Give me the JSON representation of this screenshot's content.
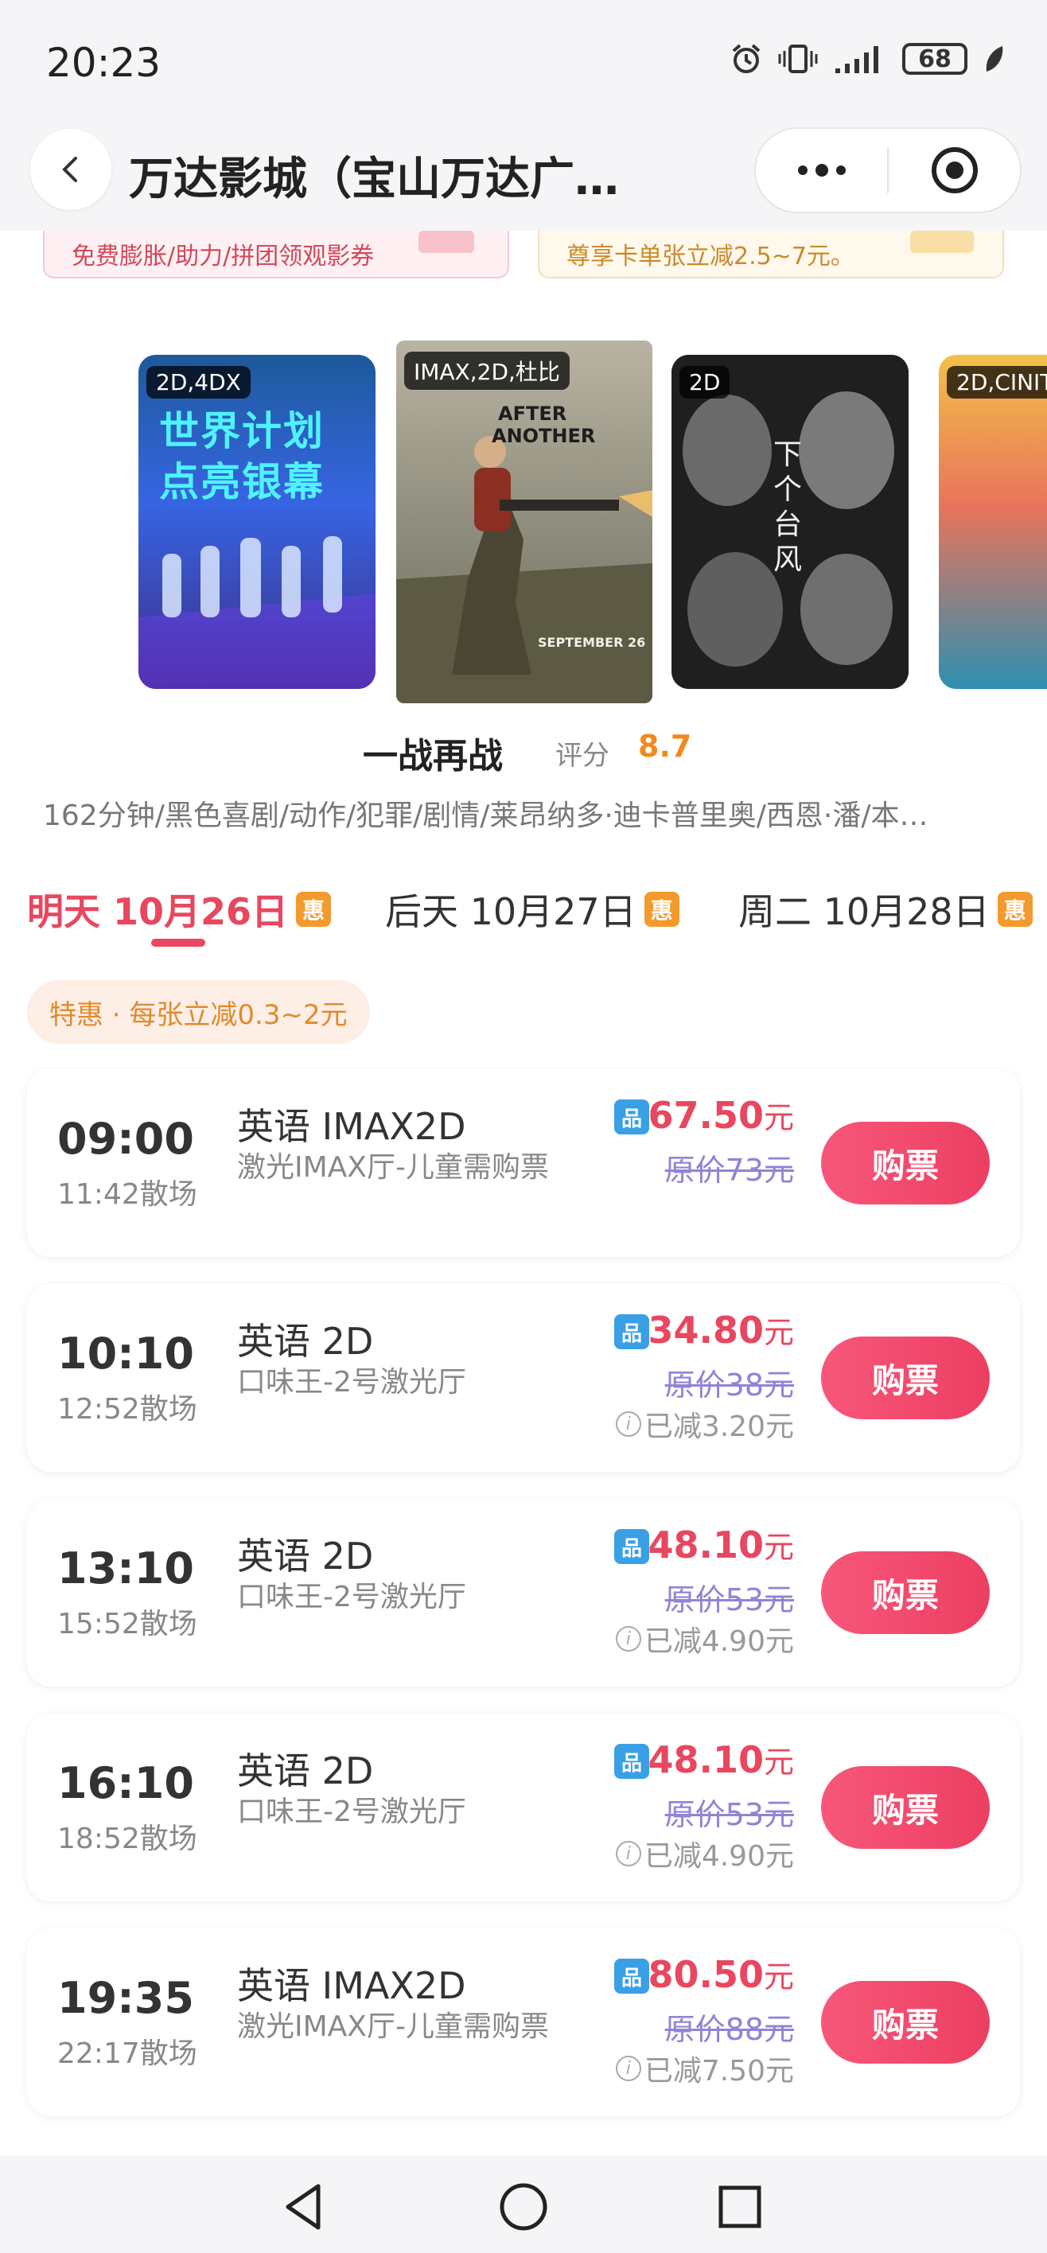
{
  "status": {
    "time": "20:23",
    "battery": "68"
  },
  "header": {
    "title": "万达影城（宝山万达广…"
  },
  "promos": {
    "left": "免费膨胀/助力/拼团领观影券",
    "right": "尊享卡单张立减2.5~7元。"
  },
  "posters": [
    {
      "tag": "2D,4DX",
      "line1": "世界计划",
      "line2": "点亮银幕"
    },
    {
      "tag": "IMAX,2D,杜比",
      "line1": "AFTER",
      "line2": "ANOTHER",
      "line3": "SEPTEMBER 26"
    },
    {
      "tag": "2D",
      "line1": "下",
      "line2": "个",
      "line3": "台",
      "line4": "风"
    },
    {
      "tag": "2D,CINIT"
    }
  ],
  "movie": {
    "title": "一战再战",
    "rating_label": "评分",
    "rating": "8.7",
    "info": "162分钟/黑色喜剧/动作/犯罪/剧情/莱昂纳多·迪卡普里奥/西恩·潘/本…"
  },
  "date_tabs": [
    {
      "label": "明天 10月26日",
      "badge": "惠",
      "active": true
    },
    {
      "label": "后天 10月27日",
      "badge": "惠",
      "active": false
    },
    {
      "label": "周二 10月28日",
      "badge": "惠",
      "active": false
    }
  ],
  "discount": "特惠 · 每张立减0.3~2元",
  "showtimes": [
    {
      "time": "09:00",
      "end": "11:42散场",
      "lang": "英语 IMAX2D",
      "hall": "激光IMAX厅-儿童需购票",
      "pin": "品",
      "price": "67.50",
      "unit": "元",
      "orig": "原价73元",
      "saved": "",
      "buy": "购票"
    },
    {
      "time": "10:10",
      "end": "12:52散场",
      "lang": "英语 2D",
      "hall": "口味王-2号激光厅",
      "pin": "品",
      "price": "34.80",
      "unit": "元",
      "orig": "原价38元",
      "saved": "已减3.20元",
      "buy": "购票"
    },
    {
      "time": "13:10",
      "end": "15:52散场",
      "lang": "英语 2D",
      "hall": "口味王-2号激光厅",
      "pin": "品",
      "price": "48.10",
      "unit": "元",
      "orig": "原价53元",
      "saved": "已减4.90元",
      "buy": "购票"
    },
    {
      "time": "16:10",
      "end": "18:52散场",
      "lang": "英语 2D",
      "hall": "口味王-2号激光厅",
      "pin": "品",
      "price": "48.10",
      "unit": "元",
      "orig": "原价53元",
      "saved": "已减4.90元",
      "buy": "购票"
    },
    {
      "time": "19:35",
      "end": "22:17散场",
      "lang": "英语 IMAX2D",
      "hall": "激光IMAX厅-儿童需购票",
      "pin": "品",
      "price": "80.50",
      "unit": "元",
      "orig": "原价88元",
      "saved": "已减7.50元",
      "buy": "购票"
    }
  ],
  "colors": {
    "accent": "#e8475f",
    "rating": "#f08a1a",
    "badge": "#f39a2e",
    "pin": "#3aa0e6",
    "orig_price": "#8f84d6"
  }
}
